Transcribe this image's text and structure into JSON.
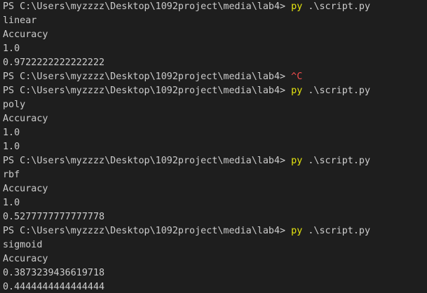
{
  "colors": {
    "background": "#1e1e1e",
    "text": "#cccccc",
    "command": "#e5e510",
    "interrupt": "#f14c4c"
  },
  "terminal": {
    "lines": [
      {
        "type": "prompt",
        "prompt": "PS C:\\Users\\myzzzz\\Desktop\\1092project\\media\\lab4> ",
        "command": "py",
        "args": " .\\script.py"
      },
      {
        "type": "output",
        "text": "linear"
      },
      {
        "type": "output",
        "text": "Accuracy"
      },
      {
        "type": "output",
        "text": "1.0"
      },
      {
        "type": "output",
        "text": "0.9722222222222222"
      },
      {
        "type": "interrupt",
        "prompt": "PS C:\\Users\\myzzzz\\Desktop\\1092project\\media\\lab4> ",
        "signal": "^C"
      },
      {
        "type": "prompt",
        "prompt": "PS C:\\Users\\myzzzz\\Desktop\\1092project\\media\\lab4> ",
        "command": "py",
        "args": " .\\script.py"
      },
      {
        "type": "output",
        "text": "poly"
      },
      {
        "type": "output",
        "text": "Accuracy"
      },
      {
        "type": "output",
        "text": "1.0"
      },
      {
        "type": "output",
        "text": "1.0"
      },
      {
        "type": "prompt",
        "prompt": "PS C:\\Users\\myzzzz\\Desktop\\1092project\\media\\lab4> ",
        "command": "py",
        "args": " .\\script.py"
      },
      {
        "type": "output",
        "text": "rbf"
      },
      {
        "type": "output",
        "text": "Accuracy"
      },
      {
        "type": "output",
        "text": "1.0"
      },
      {
        "type": "output",
        "text": "0.5277777777777778"
      },
      {
        "type": "prompt",
        "prompt": "PS C:\\Users\\myzzzz\\Desktop\\1092project\\media\\lab4> ",
        "command": "py",
        "args": " .\\script.py"
      },
      {
        "type": "output",
        "text": "sigmoid"
      },
      {
        "type": "output",
        "text": "Accuracy"
      },
      {
        "type": "output",
        "text": "0.3873239436619718"
      },
      {
        "type": "output",
        "text": "0.4444444444444444"
      }
    ]
  }
}
